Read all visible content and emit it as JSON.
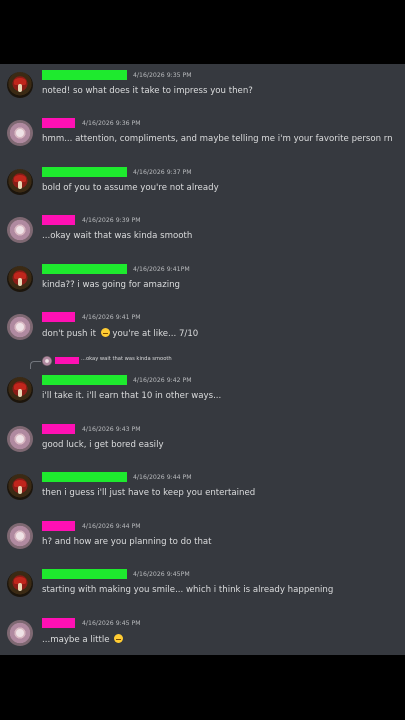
{
  "messages": [
    {
      "id": 1,
      "author": "green",
      "timestamp": "4/16/2026 9:35 PM",
      "text": "noted! so what does it take to impress you then?"
    },
    {
      "id": 2,
      "author": "pink",
      "timestamp": "4/16/2026 9:36 PM",
      "text": "hmm... attention, compliments, and maybe telling me i'm your favorite person rn"
    },
    {
      "id": 3,
      "author": "green",
      "timestamp": "4/16/2026 9:37 PM",
      "text": "bold of you to assume you're not already"
    },
    {
      "id": 4,
      "author": "pink",
      "timestamp": "4/16/2026 9:39 PM",
      "text": "...okay wait that was kinda smooth"
    },
    {
      "id": 5,
      "author": "green",
      "timestamp": "4/16/2026 9:41PM",
      "text": "kinda?? i was going for amazing"
    },
    {
      "id": 6,
      "author": "pink",
      "timestamp": "4/16/2026 9:41 PM",
      "text_a": "don't push it",
      "text_b": "you're at like... 7/10"
    },
    {
      "id": 7,
      "author": "green",
      "timestamp": "4/16/2026 9:42 PM",
      "text": "i'll take it. i'll earn that 10 in other ways...",
      "reply_text": "...okay wait that was kinda smooth"
    },
    {
      "id": 8,
      "author": "pink",
      "timestamp": "4/16/2026 9:43 PM",
      "text": "good luck, i get bored easily"
    },
    {
      "id": 9,
      "author": "green",
      "timestamp": "4/16/2026 9:44 PM",
      "text": "then i guess i'll just have to keep you entertained"
    },
    {
      "id": 10,
      "author": "pink",
      "timestamp": "4/16/2026 9:44 PM",
      "text": "h? and how are you planning to do that"
    },
    {
      "id": 11,
      "author": "green",
      "timestamp": "4/16/2026 9:45PM",
      "text": "starting with making you smile... which i think is already happening"
    },
    {
      "id": 12,
      "author": "pink",
      "timestamp": "4/16/2026 9:45 PM",
      "text": "...maybe a little"
    }
  ],
  "colors": {
    "green_name": "#1eea2e",
    "pink_name": "#ff10b4",
    "chat_bg": "#36393f",
    "text": "#dcddde",
    "timestamp": "#b9bbbe"
  },
  "icons": {
    "emoji_6": "upside-down-face-emoji",
    "emoji_12": "upside-down-face-emoji"
  }
}
